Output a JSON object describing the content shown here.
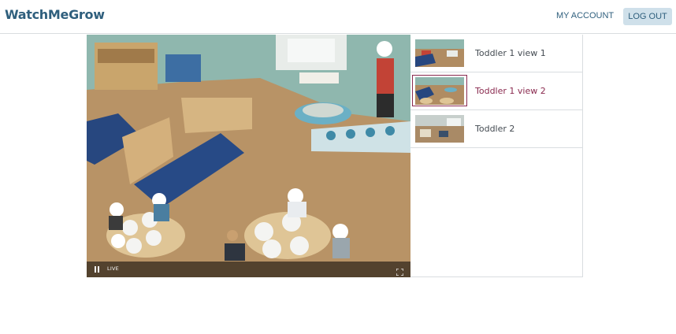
{
  "header": {
    "logo_text": "WatchMeGrow",
    "my_account_label": "MY ACCOUNT",
    "logout_label": "LOG OUT"
  },
  "player": {
    "status_label": "LIVE",
    "pause_icon": "pause-icon",
    "fullscreen_icon": "fullscreen-icon"
  },
  "cameras": [
    {
      "label": "Toddler 1 view 1",
      "active": false
    },
    {
      "label": "Toddler 1 view 2",
      "active": true
    },
    {
      "label": "Toddler 2",
      "active": false
    }
  ],
  "colors": {
    "brand": "#2f5f7d",
    "logout_bg": "#cfe0ea",
    "active_camera": "#8a2a4f",
    "divider": "#d9dde0"
  }
}
